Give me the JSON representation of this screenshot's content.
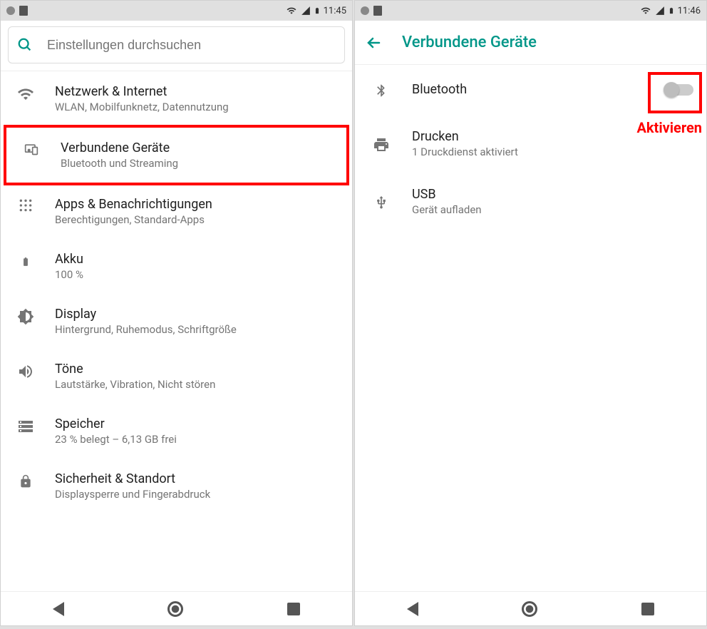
{
  "left": {
    "time": "11:45",
    "search_placeholder": "Einstellungen durchsuchen",
    "items": [
      {
        "title": "Netzwerk & Internet",
        "subtitle": "WLAN, Mobilfunknetz, Datennutzung",
        "icon": "wifi-icon"
      },
      {
        "title": "Verbundene Geräte",
        "subtitle": "Bluetooth und Streaming",
        "icon": "devices-icon",
        "highlight": true
      },
      {
        "title": "Apps & Benachrichtigungen",
        "subtitle": "Berechtigungen, Standard-Apps",
        "icon": "apps-icon"
      },
      {
        "title": "Akku",
        "subtitle": "100 %",
        "icon": "battery-icon"
      },
      {
        "title": "Display",
        "subtitle": "Hintergrund, Ruhemodus, Schriftgröße",
        "icon": "display-icon"
      },
      {
        "title": "Töne",
        "subtitle": "Lautstärke, Vibration, Nicht stören",
        "icon": "sound-icon"
      },
      {
        "title": "Speicher",
        "subtitle": "23 % belegt – 6,13 GB frei",
        "icon": "storage-icon"
      },
      {
        "title": "Sicherheit & Standort",
        "subtitle": "Displaysperre und Fingerabdruck",
        "icon": "security-icon"
      }
    ]
  },
  "right": {
    "time": "11:46",
    "apptitle": "Verbundene Geräte",
    "annotation": "Aktivieren",
    "items": [
      {
        "title": "Bluetooth",
        "subtitle": "",
        "icon": "bluetooth-icon",
        "toggle": true
      },
      {
        "title": "Drucken",
        "subtitle": "1 Druckdienst aktiviert",
        "icon": "print-icon"
      },
      {
        "title": "USB",
        "subtitle": "Gerät aufladen",
        "icon": "usb-icon"
      }
    ]
  }
}
